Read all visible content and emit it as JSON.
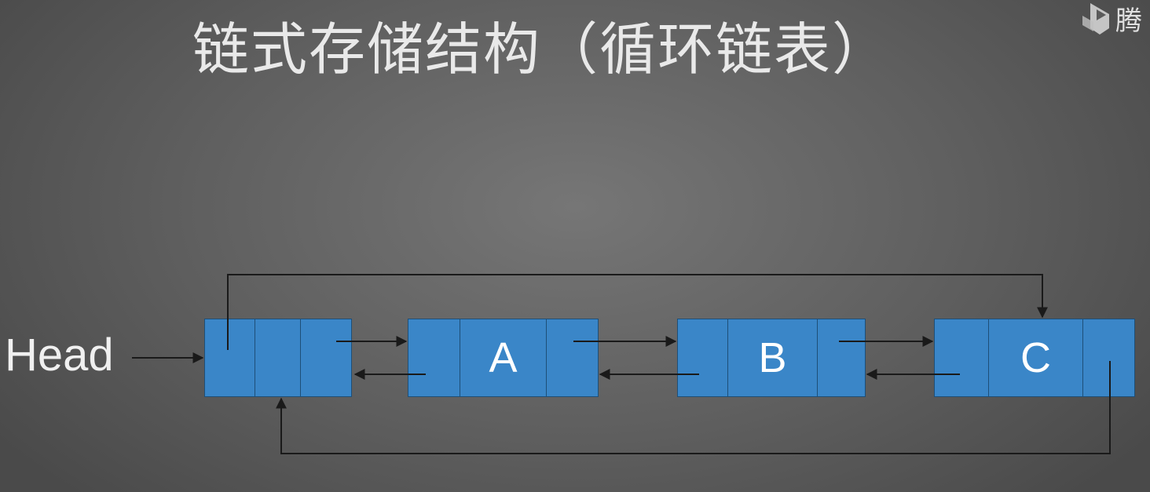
{
  "title": "链式存储结构（循环链表）",
  "head_label": "Head",
  "logo_partial_char": "腾",
  "nodes": [
    {
      "name": "head-node",
      "label": ""
    },
    {
      "name": "node-a",
      "label": "A"
    },
    {
      "name": "node-b",
      "label": "B"
    },
    {
      "name": "node-c",
      "label": "C"
    }
  ],
  "colors": {
    "background": "#666666",
    "node_fill": "#3a86c8",
    "node_border": "#1e4f78",
    "arrow": "#1a1a1a",
    "title_text": "#e9e9e9"
  },
  "icons": [
    "tencent-video-logo-icon"
  ]
}
